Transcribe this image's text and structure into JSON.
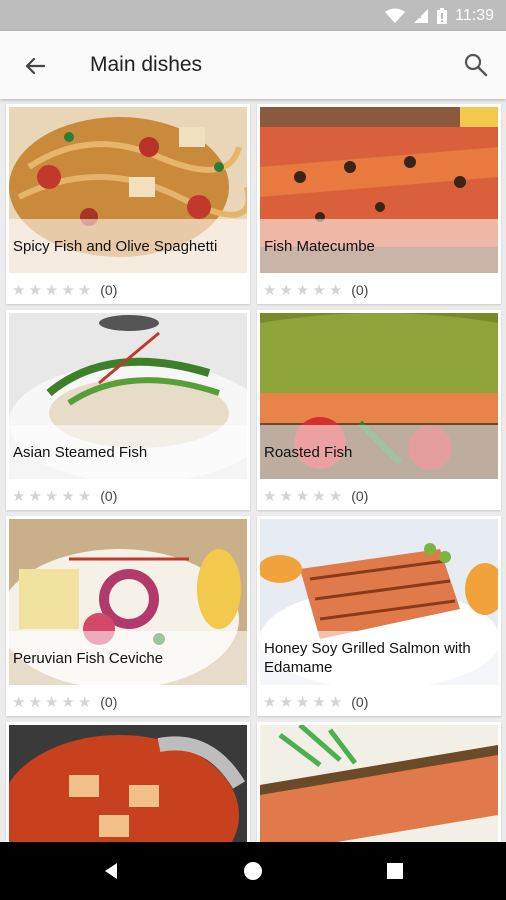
{
  "status": {
    "time": "11:39"
  },
  "appbar": {
    "title": "Main dishes",
    "back_icon": "arrow-back-icon",
    "search_icon": "search-icon"
  },
  "recipes": [
    {
      "name": "Spicy Fish and Olive Spaghetti",
      "rating_count": "(0)",
      "stars": 0
    },
    {
      "name": "Fish Matecumbe",
      "rating_count": "(0)",
      "stars": 0
    },
    {
      "name": "Asian Steamed Fish",
      "rating_count": "(0)",
      "stars": 0
    },
    {
      "name": "Roasted Fish",
      "rating_count": "(0)",
      "stars": 0
    },
    {
      "name": "Peruvian Fish Ceviche",
      "rating_count": "(0)",
      "stars": 0
    },
    {
      "name": "Honey Soy Grilled Salmon with Edamame",
      "rating_count": "(0)",
      "stars": 0
    },
    {
      "name": "",
      "rating_count": "",
      "stars": 0
    },
    {
      "name": "",
      "rating_count": "",
      "stars": 0
    }
  ],
  "colors": {
    "status_bar": "#bdbdbd",
    "app_bar": "#fafafa",
    "background": "#ececec",
    "star_empty": "#d4d4d4",
    "nav_bar": "#000000"
  }
}
